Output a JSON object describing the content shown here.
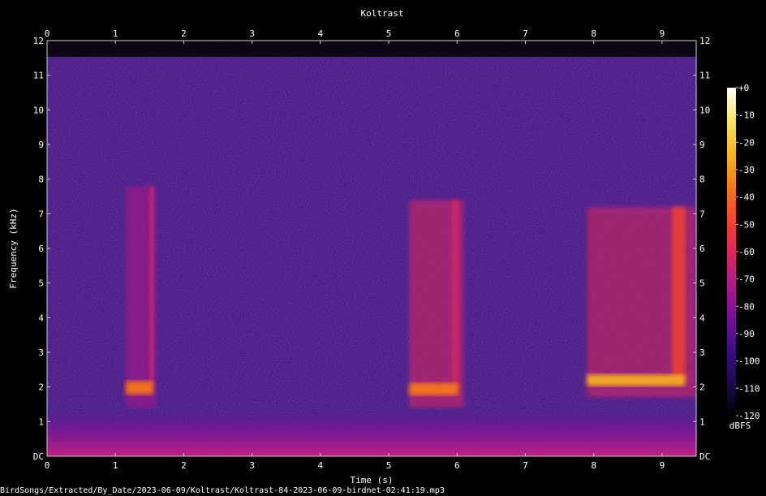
{
  "chart_data": {
    "type": "heatmap",
    "title": "Koltrast",
    "xlabel": "Time (s)",
    "ylabel": "Frequency (kHz)",
    "xlim": [
      0,
      9.5
    ],
    "ylim": [
      0,
      12
    ],
    "x_ticks": [
      "0",
      "1",
      "2",
      "3",
      "4",
      "5",
      "6",
      "7",
      "8",
      "9"
    ],
    "y_ticks": [
      "DC",
      "1",
      "2",
      "3",
      "4",
      "5",
      "6",
      "7",
      "8",
      "9",
      "10",
      "11",
      "12"
    ],
    "colorbar": {
      "label": "dBFS",
      "ticks": [
        "+0",
        "-10",
        "-20",
        "-30",
        "-40",
        "-50",
        "-60",
        "-70",
        "-80",
        "-90",
        "-100",
        "-110",
        "-120"
      ],
      "range": [
        -120,
        0
      ],
      "colors": [
        "#000000",
        "#1b0a4d",
        "#3d0f85",
        "#7a1099",
        "#b3168a",
        "#e0255e",
        "#f5452d",
        "#fb7a14",
        "#fbb51a",
        "#f8e65a",
        "#ffffff"
      ]
    },
    "background_color": "#2a0a6e",
    "events": [
      {
        "t0": 1.15,
        "t1": 1.6,
        "f0": 1.4,
        "f1": 7.8,
        "level": -55
      },
      {
        "t0": 5.3,
        "t1": 6.1,
        "f0": 1.4,
        "f1": 7.4,
        "level": -50
      },
      {
        "t0": 7.9,
        "t1": 9.5,
        "f0": 1.7,
        "f1": 7.2,
        "level": -45
      }
    ],
    "footer": "BirdSongs/Extracted/By_Date/2023-06-09/Koltrast/Koltrast-84-2023-06-09-birdnet-02:41:19.mp3"
  }
}
